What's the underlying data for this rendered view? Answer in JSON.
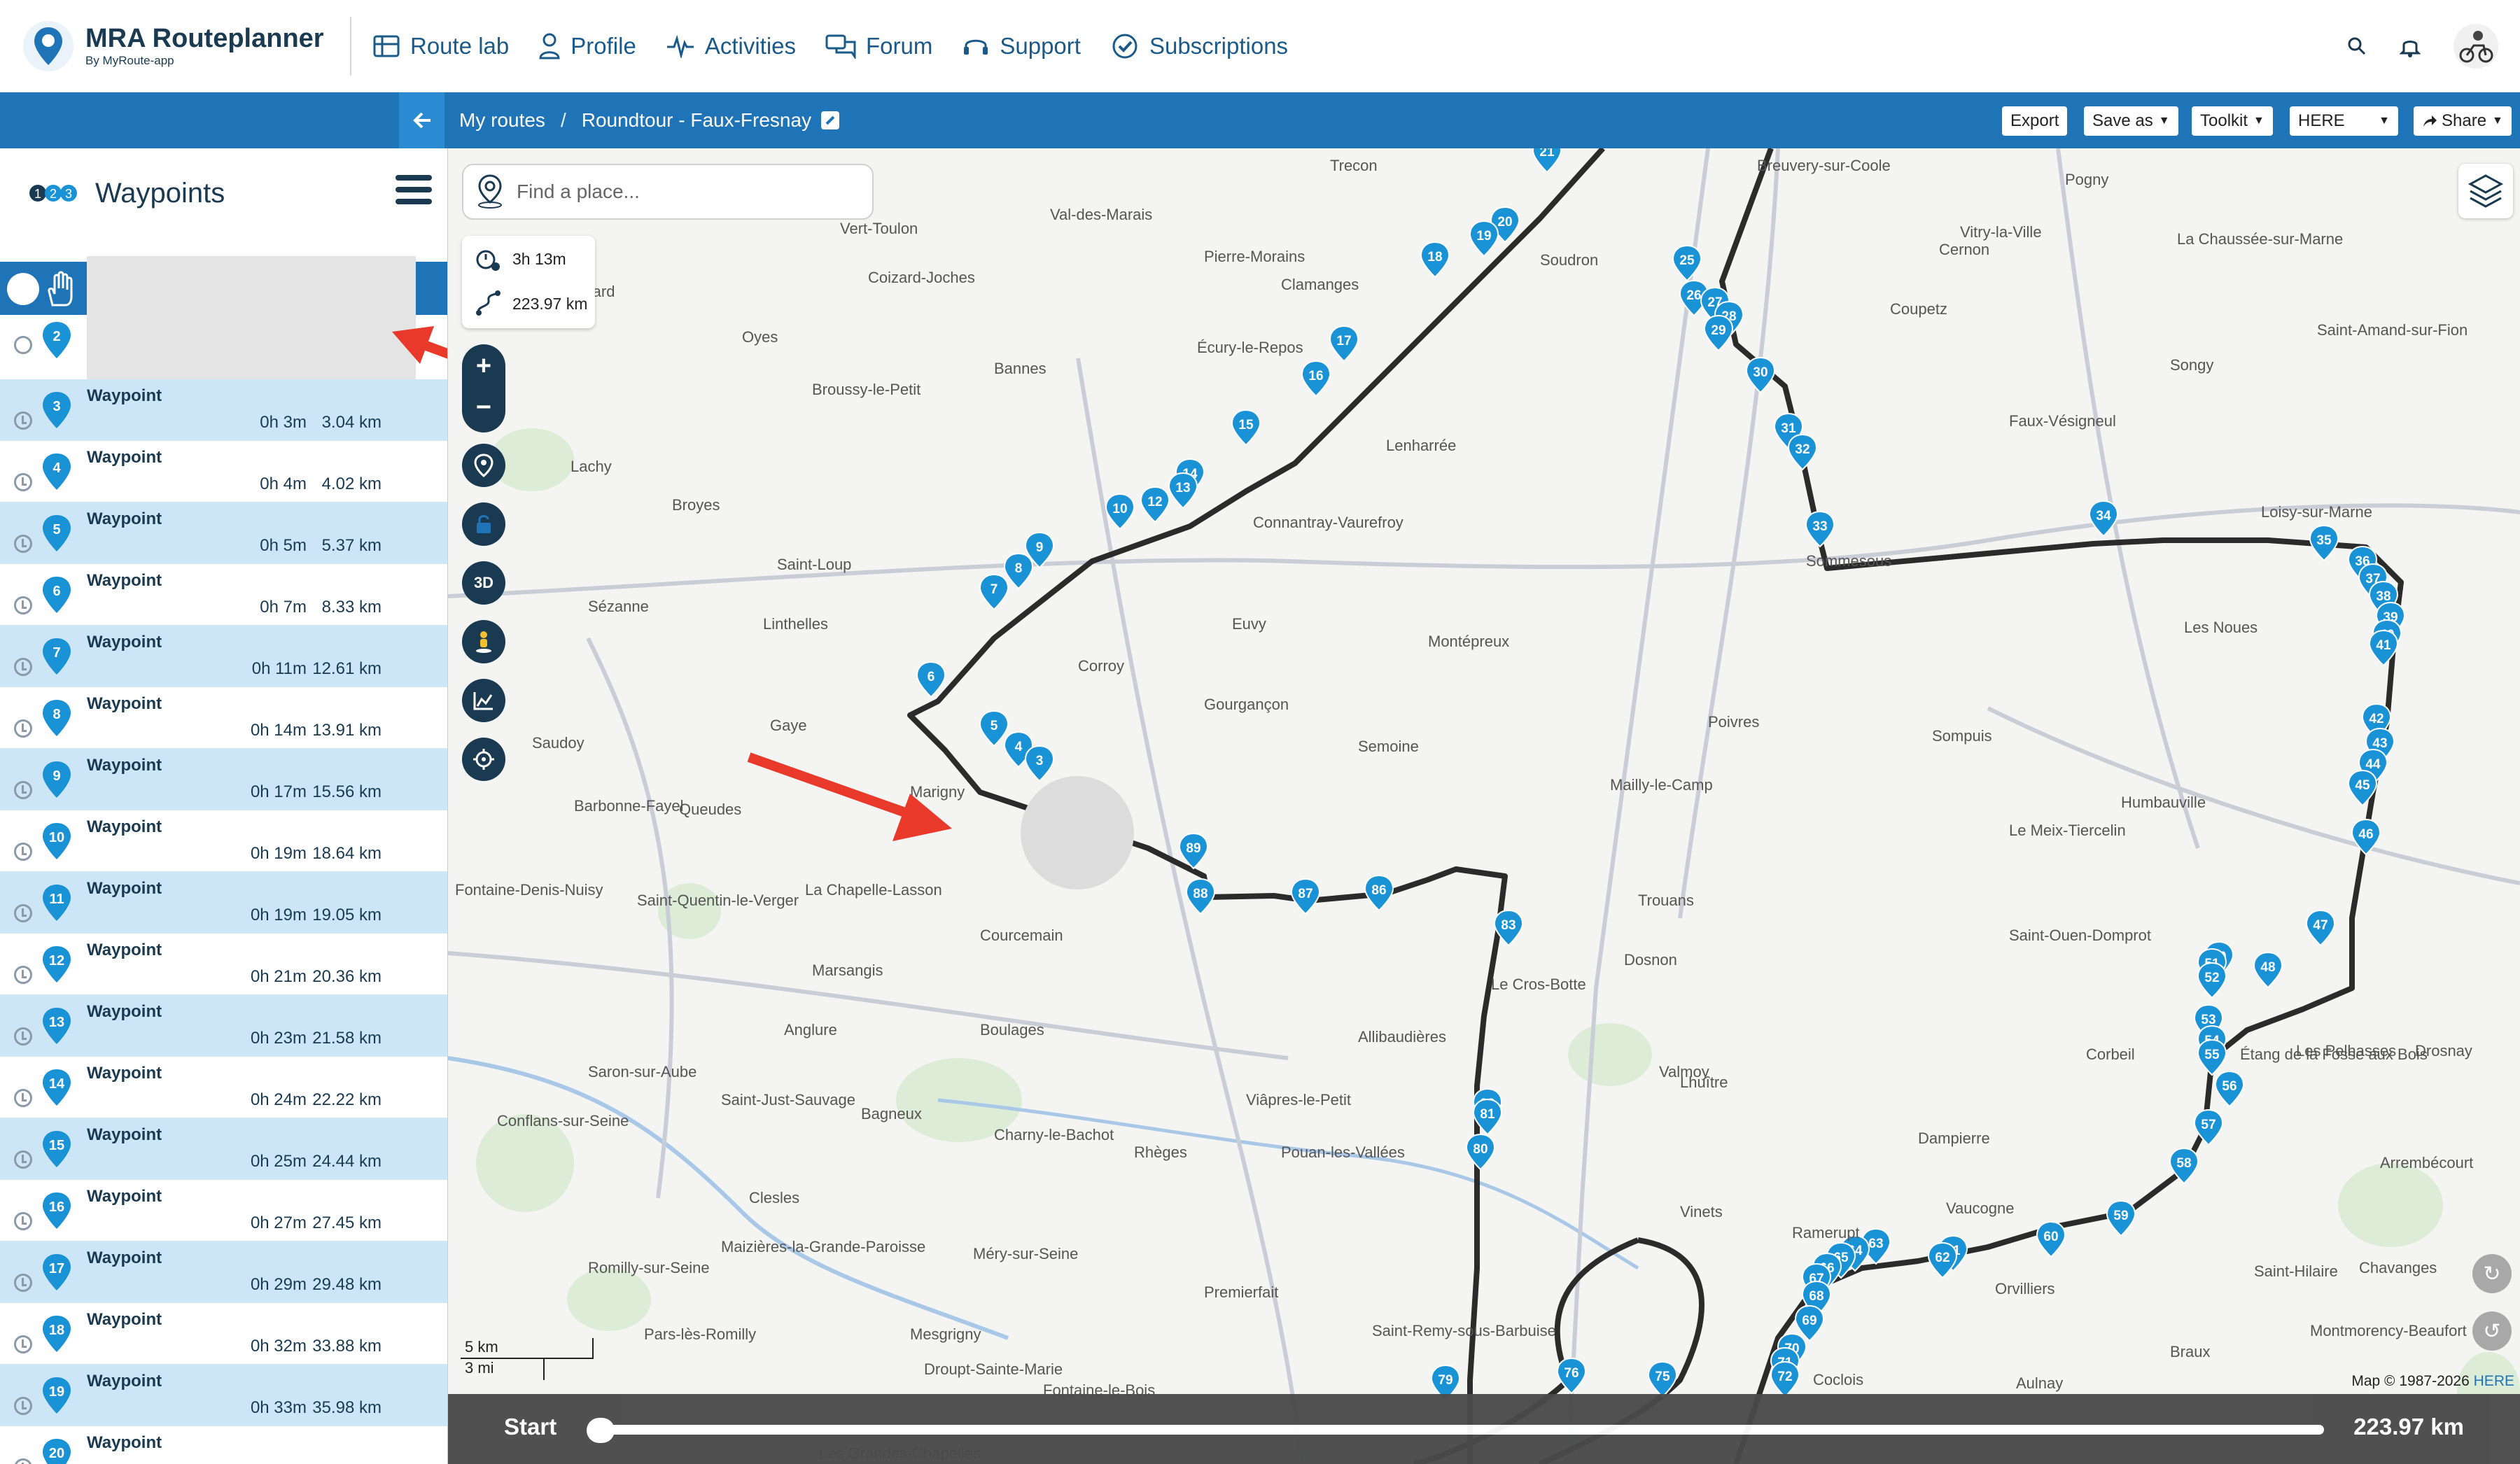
{
  "nav": {
    "brand": "MRA Routeplanner",
    "brand_sub": "By MyRoute-app",
    "items": [
      {
        "label": "Route lab",
        "icon": "map-icon"
      },
      {
        "label": "Profile",
        "icon": "user-icon"
      },
      {
        "label": "Activities",
        "icon": "pulse-icon"
      },
      {
        "label": "Forum",
        "icon": "chat-icon"
      },
      {
        "label": "Support",
        "icon": "headset-icon"
      },
      {
        "label": "Subscriptions",
        "icon": "badge-icon"
      }
    ]
  },
  "breadcrumb": {
    "root": "My routes",
    "separator": "/",
    "current": "Roundtour - Faux-Fresnay"
  },
  "toolbar": {
    "export": "Export",
    "save_as": "Save as",
    "toolkit": "Toolkit",
    "provider": "HERE",
    "share": "Share"
  },
  "sidebar": {
    "title": "Waypoints",
    "badge_numbers": [
      "1",
      "2",
      "3"
    ],
    "second_number": "2",
    "waypoints": [
      {
        "num": "3",
        "name": "Waypoint",
        "time": "0h 3m",
        "dist": "3.04 km"
      },
      {
        "num": "4",
        "name": "Waypoint",
        "time": "0h 4m",
        "dist": "4.02 km"
      },
      {
        "num": "5",
        "name": "Waypoint",
        "time": "0h 5m",
        "dist": "5.37 km"
      },
      {
        "num": "6",
        "name": "Waypoint",
        "time": "0h 7m",
        "dist": "8.33 km"
      },
      {
        "num": "7",
        "name": "Waypoint",
        "time": "0h 11m",
        "dist": "12.61 km"
      },
      {
        "num": "8",
        "name": "Waypoint",
        "time": "0h 14m",
        "dist": "13.91 km"
      },
      {
        "num": "9",
        "name": "Waypoint",
        "time": "0h 17m",
        "dist": "15.56 km"
      },
      {
        "num": "10",
        "name": "Waypoint",
        "time": "0h 19m",
        "dist": "18.64 km"
      },
      {
        "num": "11",
        "name": "Waypoint",
        "time": "0h 19m",
        "dist": "19.05 km"
      },
      {
        "num": "12",
        "name": "Waypoint",
        "time": "0h 21m",
        "dist": "20.36 km"
      },
      {
        "num": "13",
        "name": "Waypoint",
        "time": "0h 23m",
        "dist": "21.58 km"
      },
      {
        "num": "14",
        "name": "Waypoint",
        "time": "0h 24m",
        "dist": "22.22 km"
      },
      {
        "num": "15",
        "name": "Waypoint",
        "time": "0h 25m",
        "dist": "24.44 km"
      },
      {
        "num": "16",
        "name": "Waypoint",
        "time": "0h 27m",
        "dist": "27.45 km"
      },
      {
        "num": "17",
        "name": "Waypoint",
        "time": "0h 29m",
        "dist": "29.48 km"
      },
      {
        "num": "18",
        "name": "Waypoint",
        "time": "0h 32m",
        "dist": "33.88 km"
      },
      {
        "num": "19",
        "name": "Waypoint",
        "time": "0h 33m",
        "dist": "35.98 km"
      },
      {
        "num": "20",
        "name": "Waypoint",
        "time": "",
        "dist": ""
      }
    ]
  },
  "map": {
    "search_placeholder": "Find a place...",
    "stats": {
      "duration": "3h 13m",
      "distance": "223.97 km"
    },
    "zoom_in": "+",
    "zoom_out": "−",
    "btn_3d": "3D",
    "scale_km": "5 km",
    "scale_mi": "3 mi",
    "copyright": "Map © 1987-2026",
    "copyright_link": "HERE",
    "slider": {
      "start_label": "Start",
      "end_label": "223.97 km",
      "progress": 0
    },
    "route_color": "#2b2b2b",
    "marker_color": "#1a93d6",
    "towns": [
      "Trecon",
      "Vert-Toulon",
      "Val-des-Marais",
      "Pierre-Morains",
      "Clamanges",
      "Soudron",
      "Breuvery-sur-Coole",
      "Pogny",
      "Vitry-la-Ville",
      "Cernon",
      "La Chaussée-sur-Marne",
      "Villevenard",
      "Coizard-Joches",
      "Oyes",
      "Bannes",
      "Écury-le-Repos",
      "Coupetz",
      "Saint-Amand-sur-Fion",
      "Broussy-le-Petit",
      "Songy",
      "Lachy",
      "Lenharrée",
      "Faux-Vésigneul",
      "Broyes",
      "Connantray-Vaurefroy",
      "Loisy-sur-Marne",
      "Saint-Loup",
      "Sommesous",
      "Sézanne",
      "Linthelles",
      "Euvy",
      "Les Noues",
      "Corroy",
      "Montépreux",
      "Gourgançon",
      "Poivres",
      "Saudoy",
      "Gaye",
      "Semoine",
      "Sompuis",
      "Marigny",
      "Mailly-le-Camp",
      "Humbauville",
      "Barbonne-Fayel",
      "Queudes",
      "Le Meix-Tiercelin",
      "Fontaine-Denis-Nuisy",
      "La Chapelle-Lasson",
      "Trouans",
      "Saint-Quentin-le-Verger",
      "Courcemain",
      "Saint-Ouen-Domprot",
      "Marsangis",
      "Dosnon",
      "Le Cros-Botte",
      "Anglure",
      "Boulages",
      "Allibaudières",
      "Corbeil",
      "Drosnay",
      "Saron-sur-Aube",
      "Valmoy",
      "Lhuître",
      "Saint-Just-Sauvage",
      "Bagneux",
      "Charny-le-Bachot",
      "Viâpres-le-Petit",
      "Conflans-sur-Seine",
      "Rhèges",
      "Pouan-les-Vallées",
      "Dampierre",
      "Arrembécourt",
      "Clesles",
      "Vinets",
      "Ramerupt",
      "Vaucogne",
      "Chavanges",
      "Maizières-la-Grande-Paroisse",
      "Romilly-sur-Seine",
      "Méry-sur-Seine",
      "Premierfait",
      "Pars-lès-Romilly",
      "Mesgrigny",
      "Saint-Remy-sous-Barbuise",
      "Coclois",
      "Aulnay",
      "Braux",
      "Montmorency-Beaufort",
      "Droupt-Sainte-Marie",
      "Fontaine-le-Bois",
      "Les Grandes-Chapelles",
      "Orvilliers",
      "Les Pelhasses",
      "Saint-Hilaire",
      "Étang de la Fosse aux Bois"
    ]
  }
}
